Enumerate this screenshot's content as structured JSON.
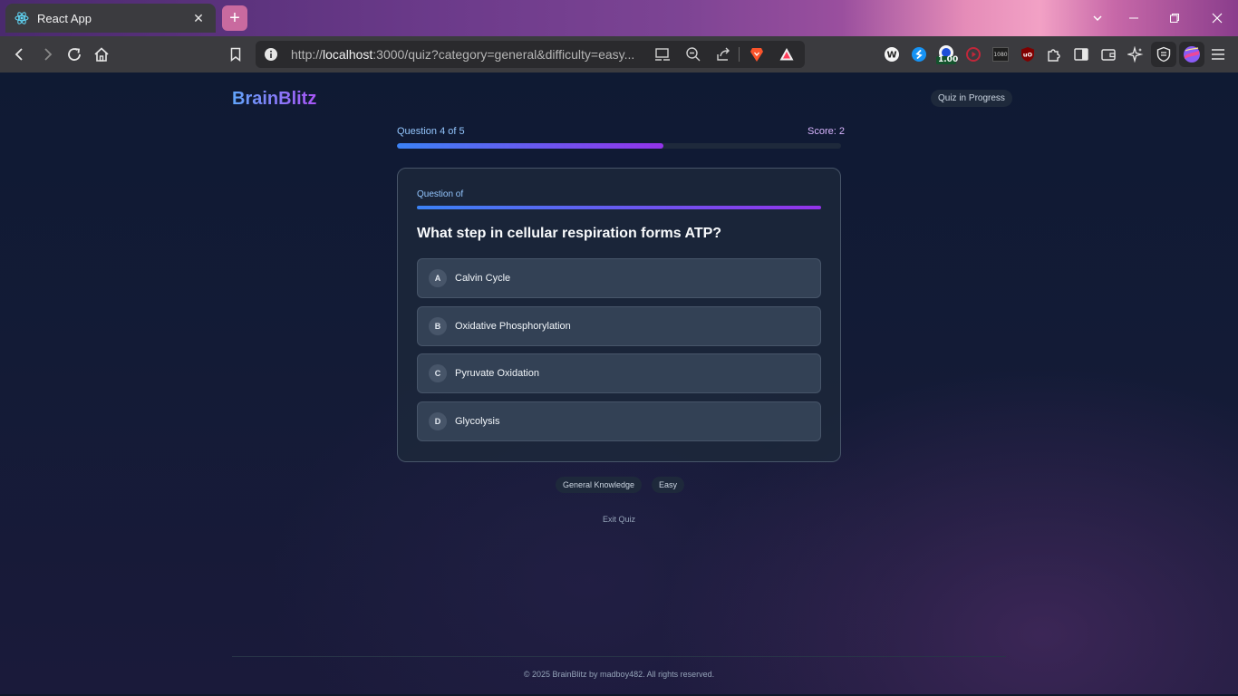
{
  "browser": {
    "tab_title": "React App",
    "new_tab": "+",
    "url_prefix": "http://",
    "url_host": "localhost",
    "url_rest": ":3000/quiz?category=general&difficulty=easy...",
    "extension_badge": "1.00",
    "extension_1080": "1080"
  },
  "app": {
    "brand": "BrainBlitz",
    "status": "Quiz in Progress"
  },
  "progress": {
    "label": "Question 4 of 5",
    "score": "Score: 2",
    "fraction": 0.6
  },
  "card": {
    "question_label": "Question of",
    "question": "What step in cellular respiration forms ATP?",
    "options": [
      {
        "letter": "A",
        "text": "Calvin Cycle"
      },
      {
        "letter": "B",
        "text": "Oxidative Phosphorylation"
      },
      {
        "letter": "C",
        "text": "Pyruvate Oxidation"
      },
      {
        "letter": "D",
        "text": "Glycolysis"
      }
    ]
  },
  "tags": [
    "General Knowledge",
    "Easy"
  ],
  "exit_label": "Exit Quiz",
  "footer": "© 2025 BrainBlitz by madboy482. All rights reserved.",
  "colors": {
    "accent_blue": "#3b82f6",
    "accent_purple": "#9333ea",
    "page_bg": "#0f172a",
    "card_bg": "#1e293b"
  }
}
